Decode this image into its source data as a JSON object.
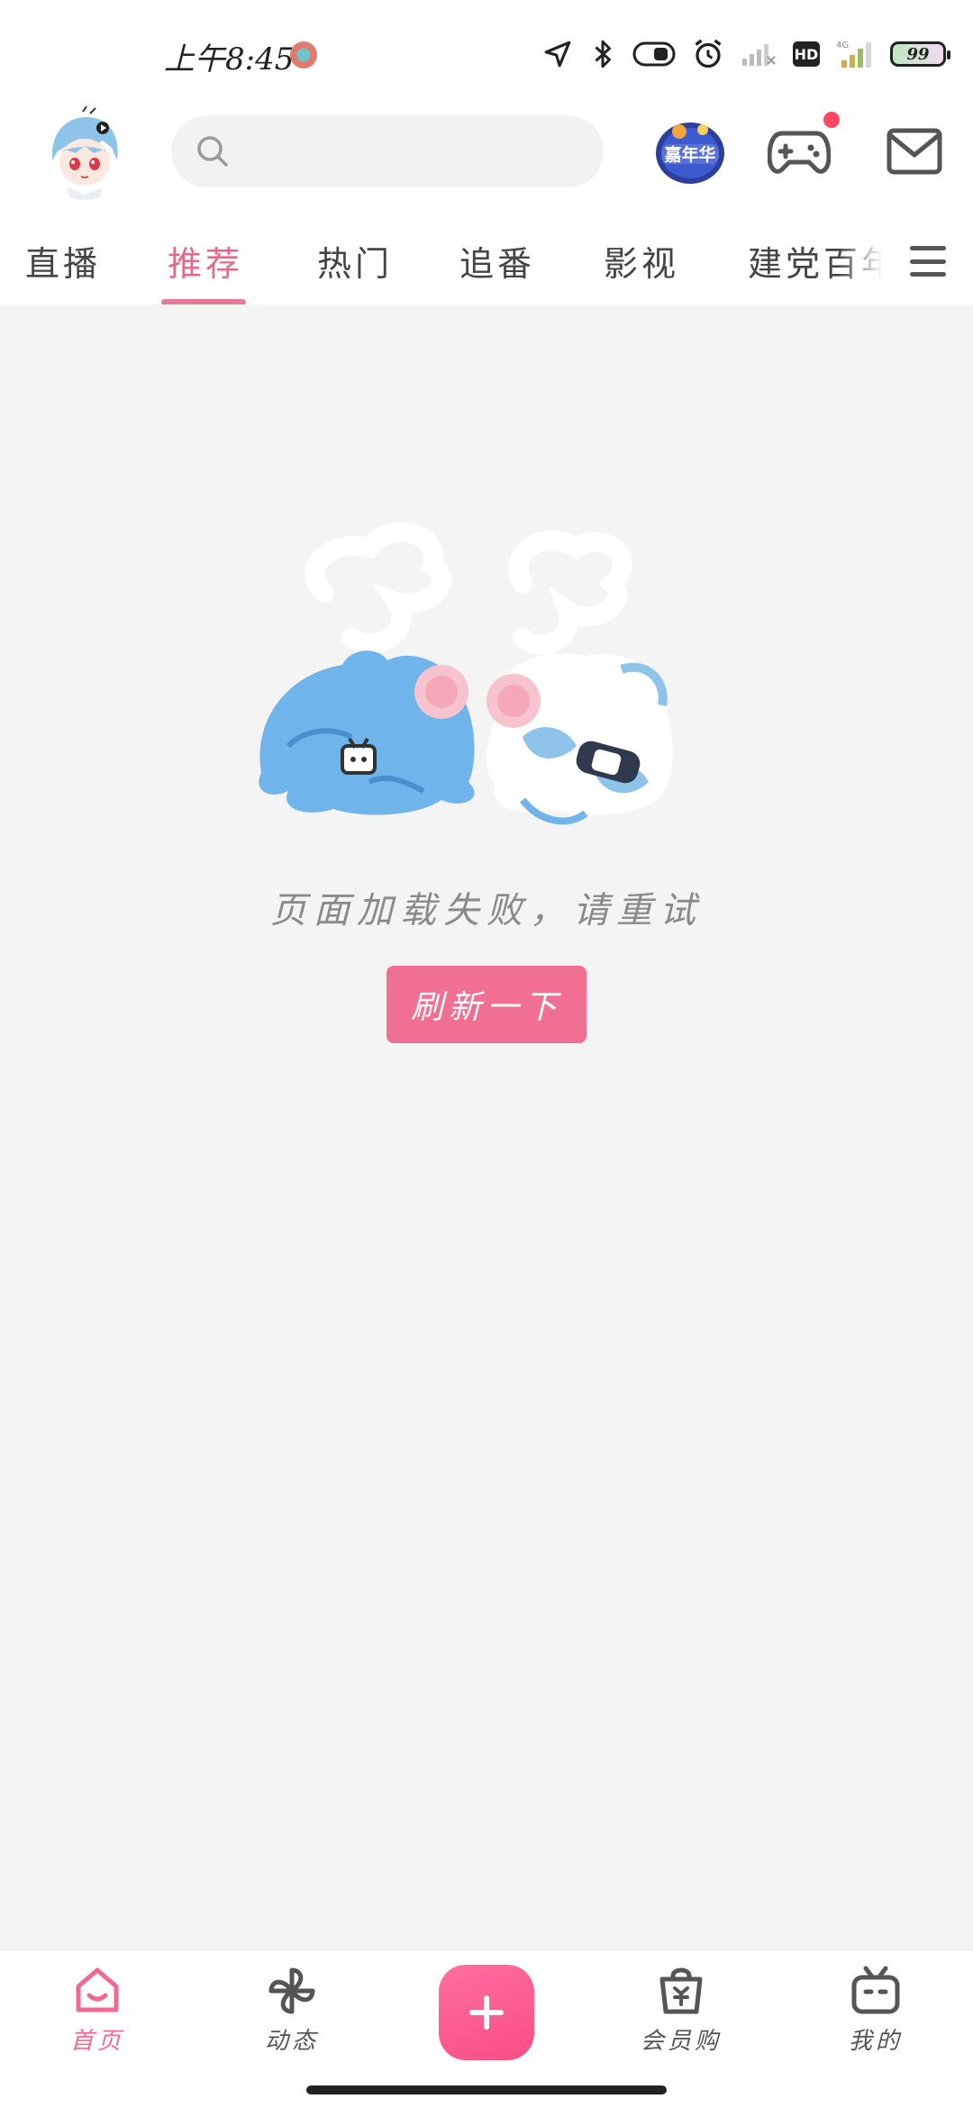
{
  "status_bar": {
    "time": "上午8:45",
    "battery": "99",
    "hd": "HD",
    "network": "4G"
  },
  "header": {
    "search_placeholder": "",
    "game_badge_text": "嘉年华"
  },
  "tabs": [
    {
      "label": "直播"
    },
    {
      "label": "推荐",
      "active": true
    },
    {
      "label": "热门"
    },
    {
      "label": "追番"
    },
    {
      "label": "影视"
    },
    {
      "label": "建党百年"
    }
  ],
  "main": {
    "error_message": "页面加载失败，请重试",
    "refresh_label": "刷新一下"
  },
  "bottom_nav": [
    {
      "label": "首页",
      "icon": "home-icon",
      "active": true
    },
    {
      "label": "动态",
      "icon": "pinwheel-icon"
    },
    {
      "label": "会员购",
      "icon": "shopping-bag-icon"
    },
    {
      "label": "我的",
      "icon": "tv-icon"
    }
  ],
  "colors": {
    "accent": "#f26f94",
    "active_tab": "#e46a8c",
    "notify": "#fb4a5f",
    "background": "#f4f4f5"
  }
}
